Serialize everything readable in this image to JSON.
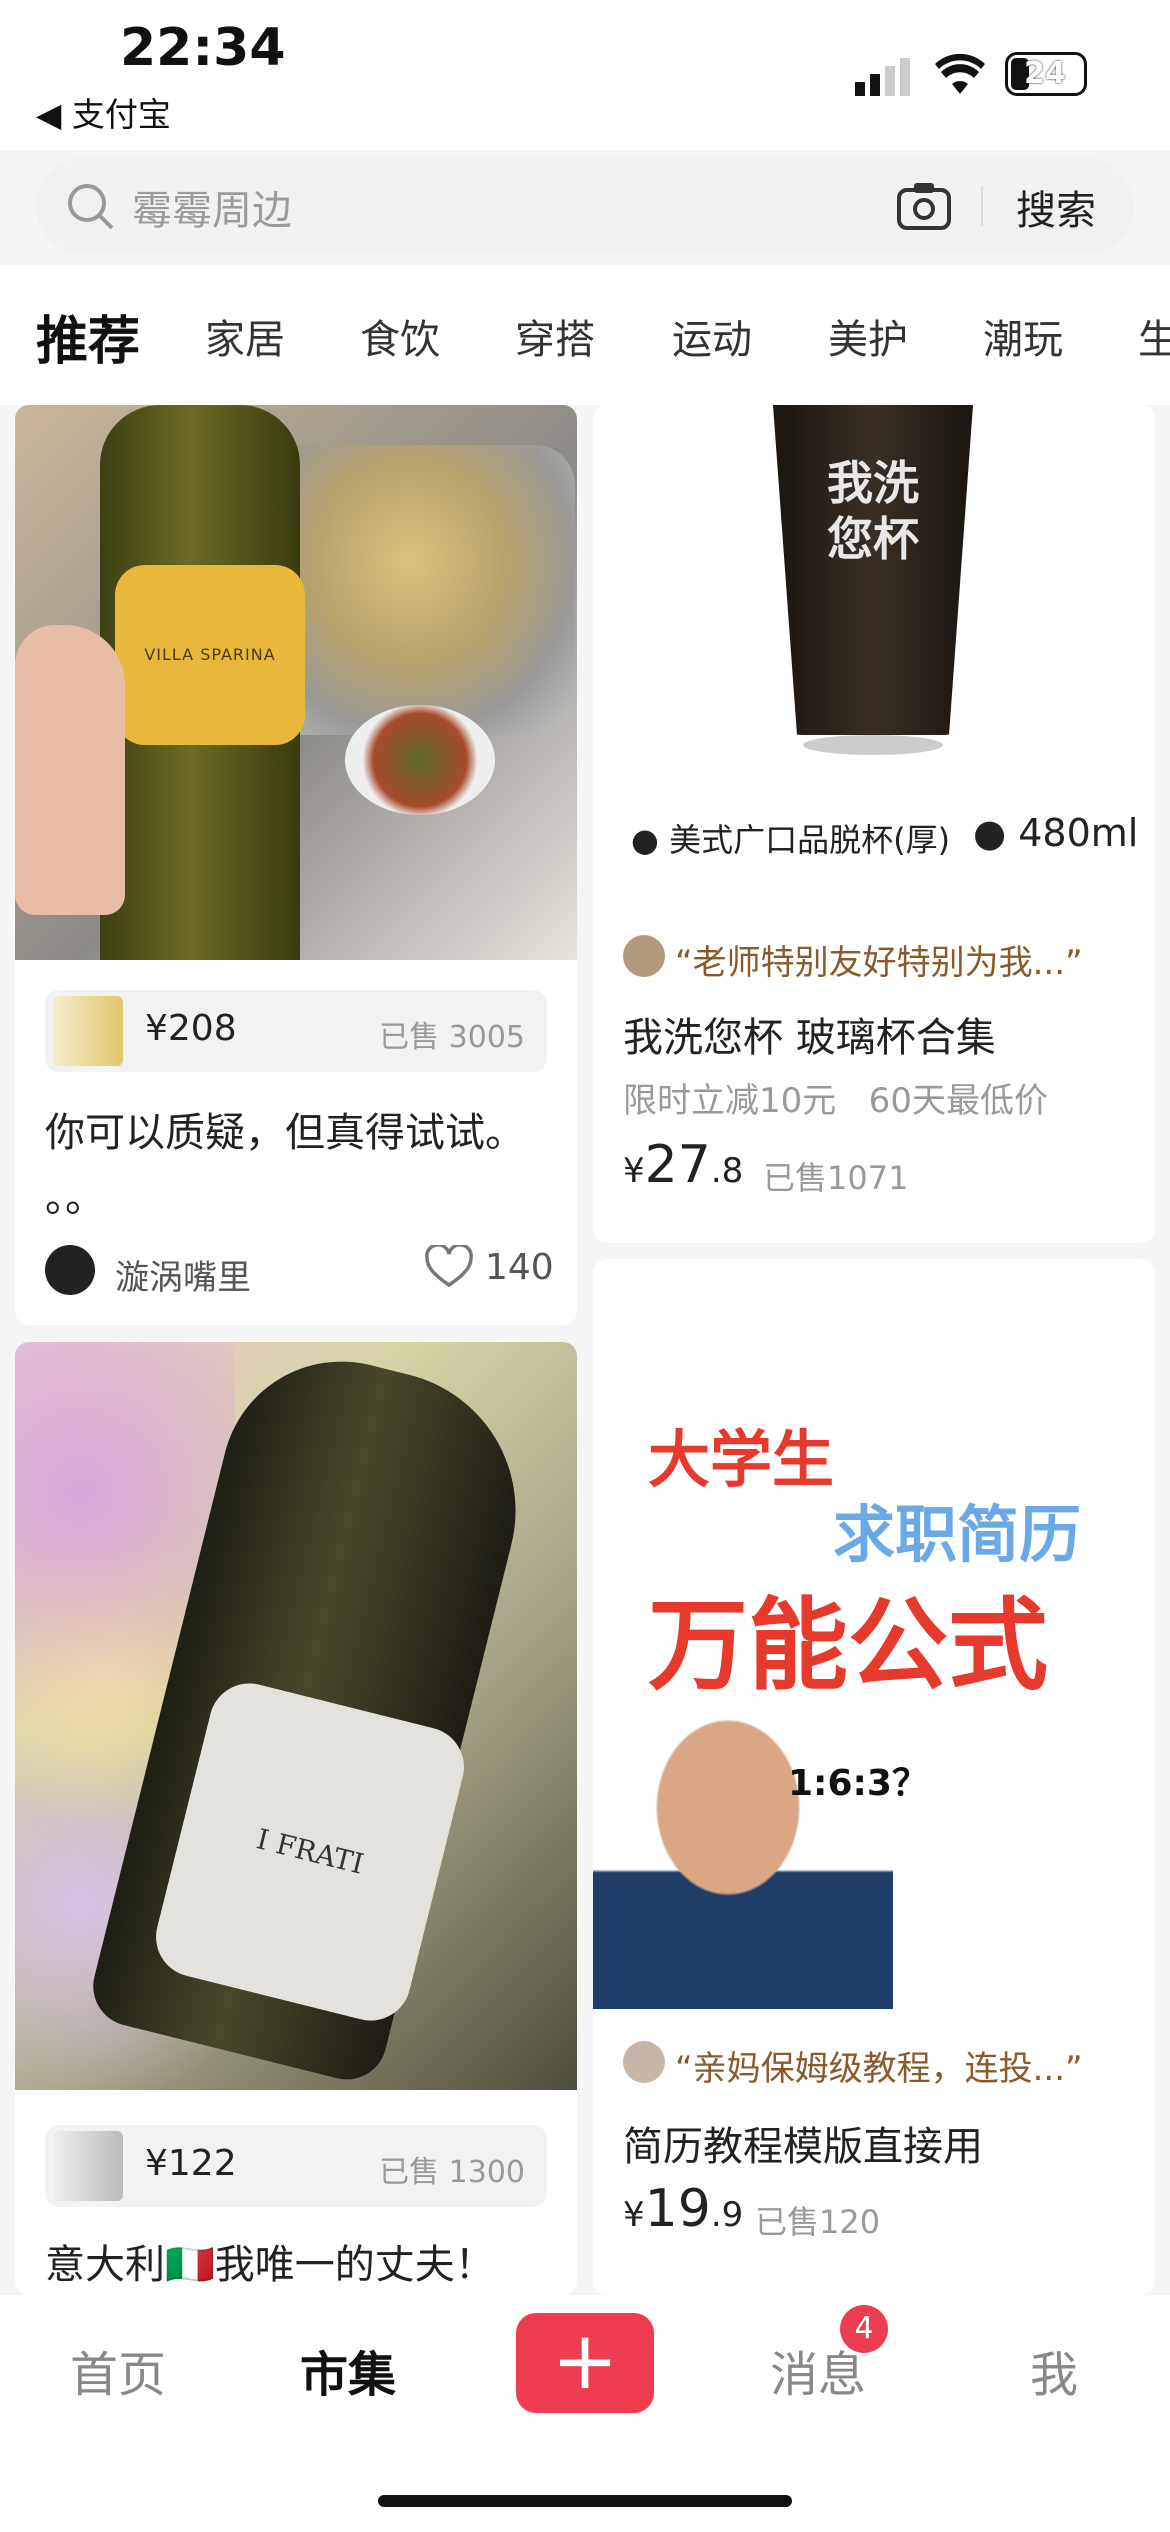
{
  "status_bar": {
    "time": "22:34",
    "back_app": "支付宝",
    "battery": "24"
  },
  "search": {
    "placeholder": "霉霉周边",
    "button": "搜索"
  },
  "tabs": [
    "推荐",
    "家居",
    "食饮",
    "穿搭",
    "运动",
    "美护",
    "潮玩",
    "生"
  ],
  "feed": {
    "left": [
      {
        "image_caption_text": "VILLA SPARINA",
        "price": "¥208",
        "sold": "已售 3005",
        "title_line1": "你可以质疑，但真得试试。",
        "title_line2": "。。",
        "author": "漩涡嘴里",
        "likes": "140"
      },
      {
        "image_caption_text": "I FRATI",
        "price": "¥122",
        "sold": "已售 1300",
        "title": "意大利🇮🇹我唯一的丈夫！"
      }
    ],
    "right": [
      {
        "glass_text": "我洗您杯",
        "spec1": "美式广口品脱杯(厚)",
        "spec2": "480ml",
        "quote": "“老师特别友好特别为我...”",
        "title": "我洗您杯 玻璃杯合集",
        "promo": "限时立减10元   60天最低价",
        "price_int": "27",
        "price_dec": ".8",
        "sold": "已售1071"
      },
      {
        "banner_line1": "大学生",
        "banner_line2": "求职简历",
        "banner_line3": "万能公式",
        "banner_tag": "1:6:3？",
        "quote": "“亲妈保姆级教程，连投...”",
        "title": "简历教程模版直接用",
        "price_int": "19",
        "price_dec": ".9",
        "sold": "已售120"
      }
    ]
  },
  "bottom_nav": {
    "home": "首页",
    "market": "市集",
    "messages": "消息",
    "messages_badge": "4",
    "me": "我"
  },
  "colors": {
    "accent": "#ef3d50",
    "quote_brown": "#8a5a2b"
  }
}
